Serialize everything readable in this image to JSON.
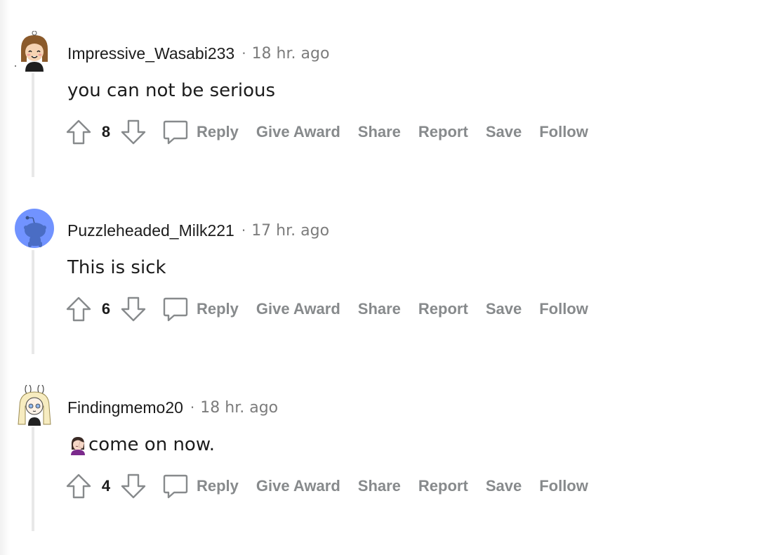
{
  "colors": {
    "text_primary": "#1c1c1c",
    "text_muted": "#7c7c7c",
    "action_gray": "#878a8c",
    "thread_line": "#e8e8e8",
    "default_avatar_bg": "#7193ff"
  },
  "comments": [
    {
      "username": "Impressive_Wasabi233",
      "separator": "·",
      "time": "18 hr. ago",
      "text": "you can not be serious",
      "score": "8",
      "avatar_icon": "girl-avatar-icon",
      "actions": {
        "reply": "Reply",
        "award": "Give Award",
        "share": "Share",
        "report": "Report",
        "save": "Save",
        "follow": "Follow"
      }
    },
    {
      "username": "Puzzleheaded_Milk221",
      "separator": "·",
      "time": "17 hr. ago",
      "text": "This is sick",
      "score": "6",
      "avatar_icon": "default-snoo-avatar-icon",
      "actions": {
        "reply": "Reply",
        "award": "Give Award",
        "share": "Share",
        "report": "Report",
        "save": "Save",
        "follow": "Follow"
      }
    },
    {
      "username": "Findingmemo20",
      "separator": "·",
      "time": "18 hr. ago",
      "text": "come on now.",
      "emoji": "woman-facepalming-emoji",
      "score": "4",
      "avatar_icon": "bunny-girl-avatar-icon",
      "actions": {
        "reply": "Reply",
        "award": "Give Award",
        "share": "Share",
        "report": "Report",
        "save": "Save",
        "follow": "Follow"
      }
    }
  ]
}
